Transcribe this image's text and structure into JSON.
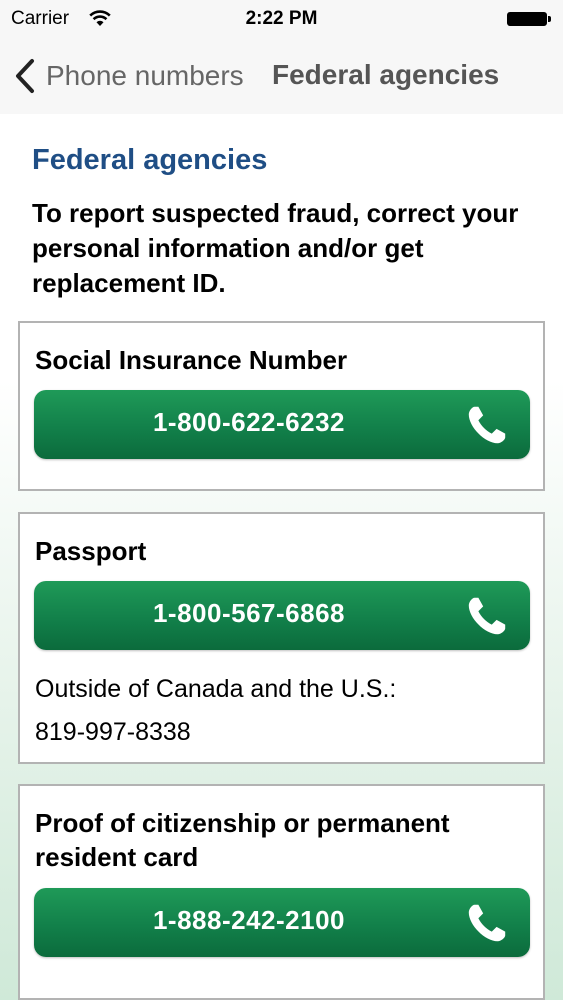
{
  "status_bar": {
    "carrier": "Carrier",
    "time": "2:22 PM"
  },
  "nav": {
    "back_label": "Phone numbers",
    "title": "Federal agencies"
  },
  "section": {
    "title": "Federal agencies",
    "intro": "To report suspected fraud, correct your personal information and/or get replacement ID."
  },
  "cards": [
    {
      "label": "Social Insurance Number",
      "phone": "1-800-622-6232"
    },
    {
      "label": "Passport",
      "phone": "1-800-567-6868",
      "note": "Outside of Canada and the U.S.:",
      "alt_phone": "819-997-8338"
    },
    {
      "label": "Proof of citizenship or permanent resident card",
      "phone": "1-888-242-2100"
    }
  ],
  "colors": {
    "accent_title": "#1f4e85",
    "button_green": "#12804a"
  },
  "icons": {
    "back": "chevron-left-icon",
    "wifi": "wifi-icon",
    "battery": "battery-icon",
    "phone": "phone-icon"
  }
}
